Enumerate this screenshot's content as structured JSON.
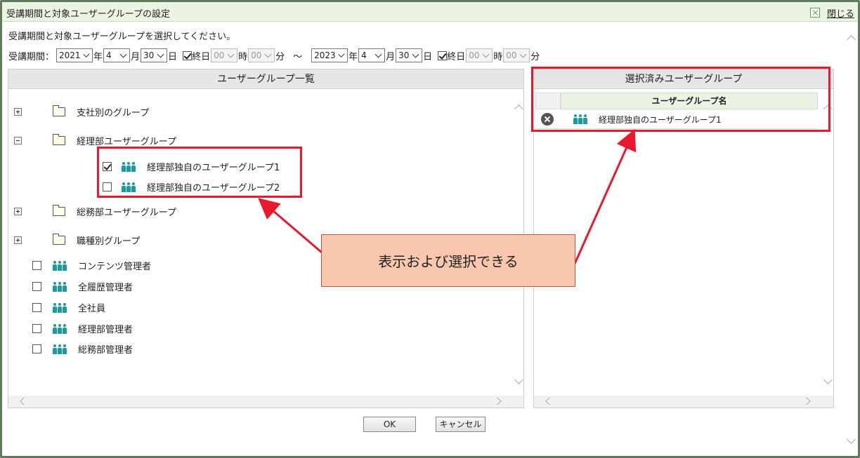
{
  "dialog": {
    "title": "受講期間と対象ユーザーグループの設定",
    "close_label": "閉じる",
    "instruction": "受講期間と対象ユーザーグループを選択してください。"
  },
  "period": {
    "label": "受講期間：",
    "start": {
      "year": "2021",
      "year_unit": "年",
      "month": "4",
      "month_unit": "月",
      "day": "30",
      "day_unit": "日",
      "allday_checked": true,
      "allday_label": "終日",
      "hour": "00",
      "hour_unit": "時",
      "minute": "00",
      "minute_unit": "分"
    },
    "separator": "～",
    "end": {
      "year": "2023",
      "year_unit": "年",
      "month": "4",
      "month_unit": "月",
      "day": "30",
      "day_unit": "日",
      "allday_checked": true,
      "allday_label": "終日",
      "hour": "00",
      "hour_unit": "時",
      "minute": "00",
      "minute_unit": "分"
    }
  },
  "left_panel": {
    "header": "ユーザーグループ一覧",
    "folders": [
      {
        "label": "支社別のグループ",
        "expanded": false,
        "icon": "folder-icon"
      },
      {
        "label": "経理部ユーザーグループ",
        "expanded": true,
        "icon": "folder-icon",
        "children": [
          {
            "label": "経理部独自のユーザーグループ1",
            "checked": true,
            "icon": "group-icon"
          },
          {
            "label": "経理部独自のユーザーグループ2",
            "checked": false,
            "icon": "group-icon"
          }
        ]
      },
      {
        "label": "総務部ユーザーグループ",
        "expanded": false,
        "icon": "folder-icon"
      },
      {
        "label": "職種別グループ",
        "expanded": false,
        "icon": "folder-icon"
      }
    ],
    "groups": [
      {
        "label": "コンテンツ管理者",
        "checked": false
      },
      {
        "label": "全履歴管理者",
        "checked": false
      },
      {
        "label": "全社員",
        "checked": false
      },
      {
        "label": "経理部管理者",
        "checked": false
      },
      {
        "label": "総務部管理者",
        "checked": false
      }
    ]
  },
  "right_panel": {
    "header": "選択済みユーザーグループ",
    "column_header": "ユーザーグループ名",
    "rows": [
      {
        "label": "経理部独自のユーザーグループ1"
      }
    ]
  },
  "buttons": {
    "ok": "OK",
    "cancel": "キャンセル"
  },
  "callout": {
    "text": "表示および選択できる",
    "color": "#f8c7ad"
  },
  "colors": {
    "accent_red": "#e8192c",
    "group_icon": "#1b9aa0",
    "title_bg": "#eaf4e2"
  }
}
